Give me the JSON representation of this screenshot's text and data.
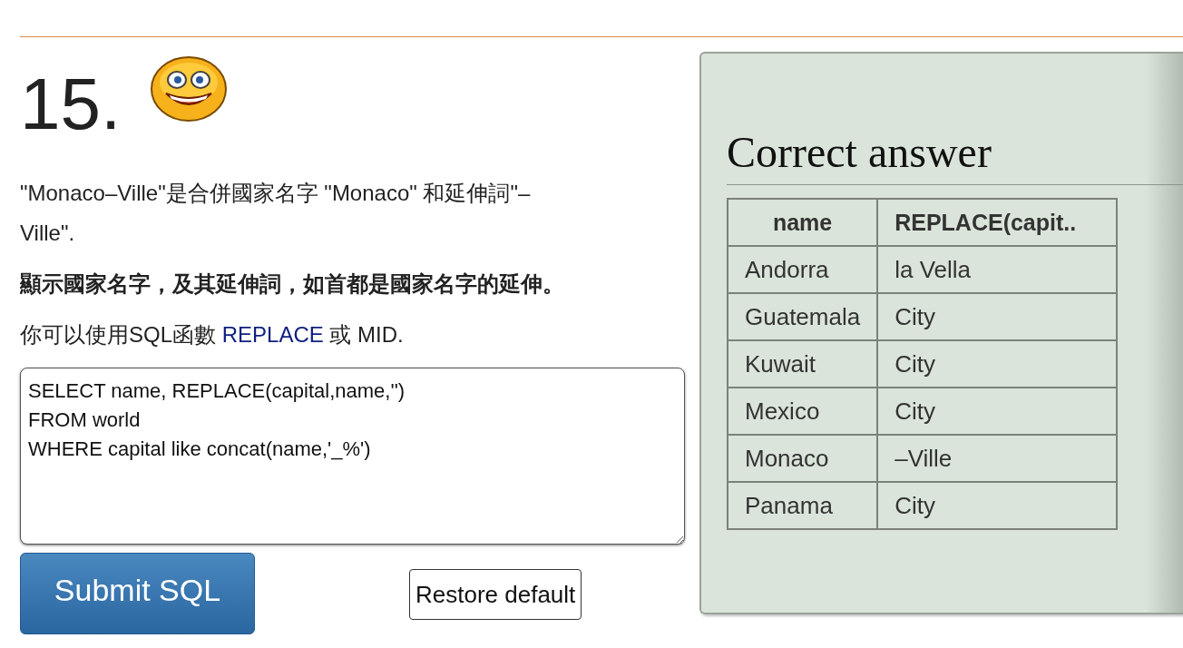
{
  "question": {
    "number": "15.",
    "intro": "\"Monaco–Ville\"是合併國家名字 \"Monaco\" 和延伸詞\"–Ville\".",
    "task": "顯示國家名字，及其延伸詞，如首都是國家名字的延伸。",
    "hint": [
      {
        "kind": "plain",
        "text": "你可以使用SQL函數 "
      },
      {
        "kind": "link",
        "text": "REPLACE"
      },
      {
        "kind": "plain",
        "text": " 或 MID."
      }
    ],
    "sql": "SELECT name, REPLACE(capital,name,'')\nFROM world\nWHERE capital like concat(name,'_%')",
    "buttons": [
      {
        "kind": "primary",
        "label": "Submit SQL"
      },
      {
        "kind": "secondary",
        "label": "Restore default"
      }
    ]
  },
  "answer": {
    "title": "Correct answer",
    "columns": [
      "name",
      "REPLACE(capit.."
    ],
    "rows": [
      [
        "Andorra",
        "la Vella"
      ],
      [
        "Guatemala",
        "City"
      ],
      [
        "Kuwait",
        "City"
      ],
      [
        "Mexico",
        "City"
      ],
      [
        "Monaco",
        "–Ville"
      ],
      [
        "Panama",
        "City"
      ]
    ]
  }
}
